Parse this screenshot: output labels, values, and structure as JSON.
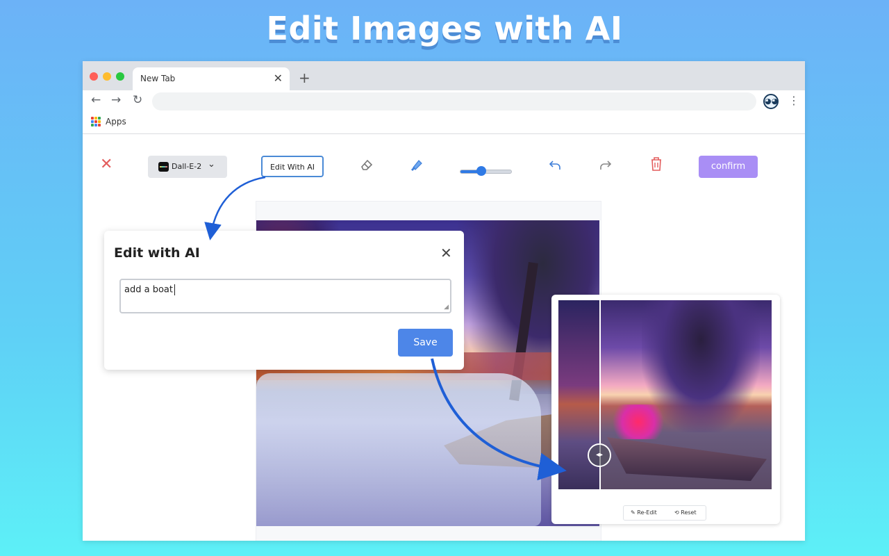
{
  "headline": "Edit Images with AI",
  "browser": {
    "tab_title": "New Tab",
    "tab_close": "✕",
    "new_tab": "+",
    "back": "←",
    "forward": "→",
    "reload": "↻",
    "menu": "⋮",
    "bookmark_label": "Apps"
  },
  "editor": {
    "close_icon": "✕",
    "model_label": "Dall-E-2",
    "edit_with_ai_label": "Edit With AI",
    "brush_size_percent": 40,
    "confirm_label": "confirm",
    "accent_color": "#a98ef5",
    "tools": [
      "eraser-icon",
      "brush-icon",
      "undo-icon",
      "redo-icon",
      "trash-icon"
    ]
  },
  "dialog": {
    "title": "Edit with AI",
    "close_icon": "✕",
    "prompt_value": "add a boat",
    "save_label": "Save"
  },
  "preview": {
    "handle_icon": "◂▸",
    "re_edit_label": "Re-Edit",
    "reset_label": "Reset"
  }
}
